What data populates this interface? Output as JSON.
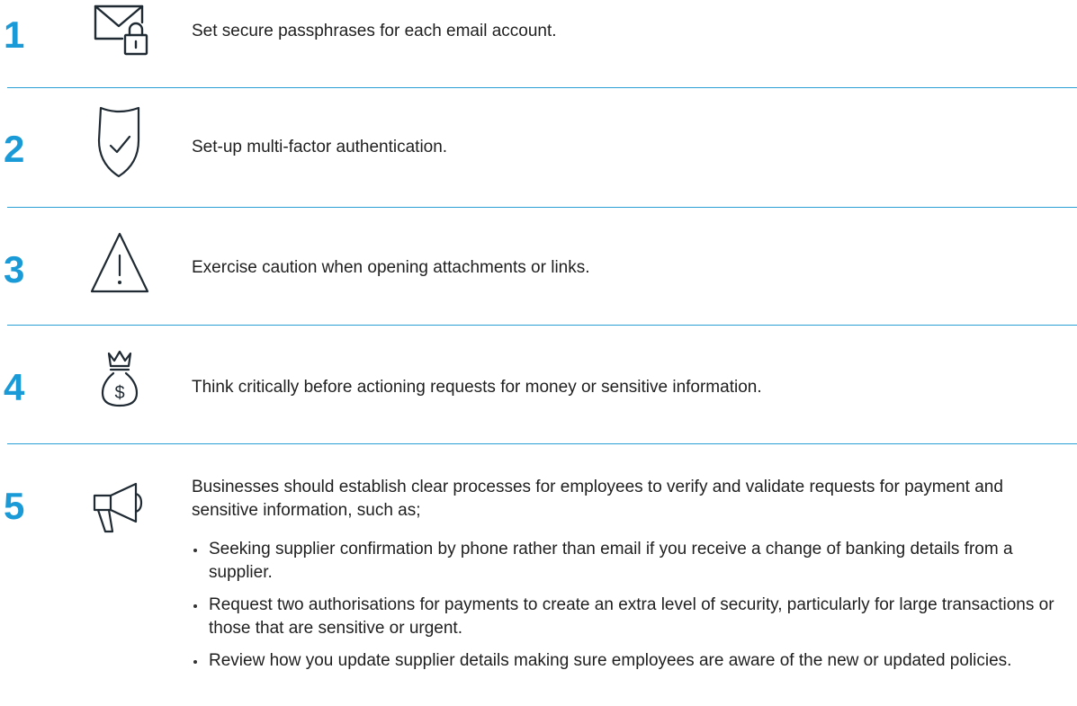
{
  "accent_color": "#1a9bd7",
  "steps": [
    {
      "number": "1",
      "icon": "envelope-lock-icon",
      "text": "Set secure passphrases for each email account."
    },
    {
      "number": "2",
      "icon": "shield-check-icon",
      "text": "Set-up multi-factor authentication."
    },
    {
      "number": "3",
      "icon": "warning-triangle-icon",
      "text": "Exercise caution when opening attachments or links."
    },
    {
      "number": "4",
      "icon": "money-bag-icon",
      "text": "Think critically before actioning requests for money or sensitive information."
    },
    {
      "number": "5",
      "icon": "megaphone-icon",
      "text": "Businesses should establish clear processes for employees to verify and validate requests for payment and sensitive information, such as;",
      "bullets": [
        "Seeking supplier confirmation by phone rather than email if you receive a change of banking details from a supplier.",
        "Request two authorisations for payments to create an extra level of security, particularly for large transactions or those that are sensitive or urgent.",
        "Review how you update supplier details making sure employees are aware of the new or updated policies."
      ]
    }
  ]
}
